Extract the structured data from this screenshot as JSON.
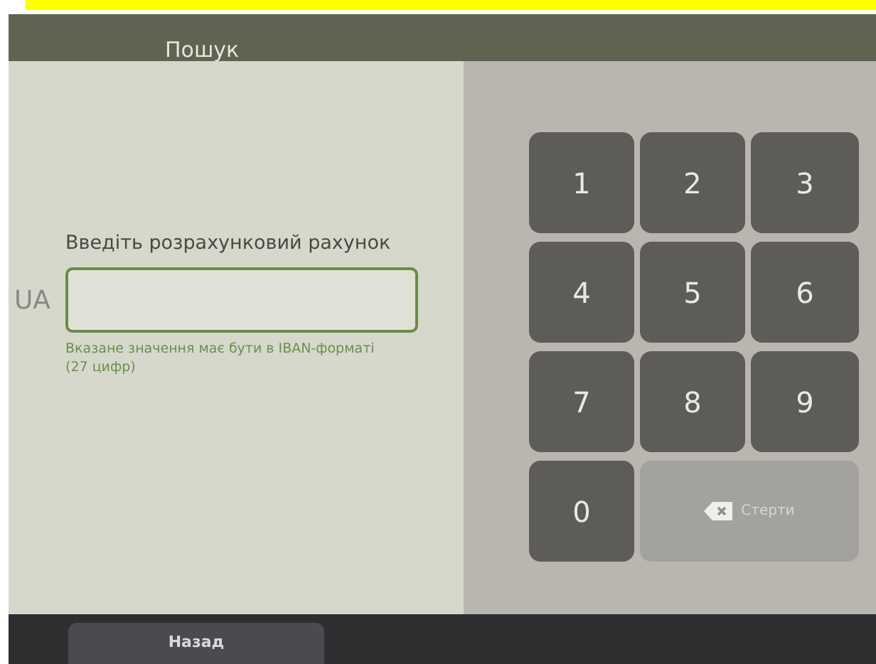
{
  "header": {
    "title": "Пошук"
  },
  "form": {
    "label": "Введіть розрахунковий рахунок",
    "prefix": "UA",
    "hint": "Вказане значення має бути в IBAN-форматі (27 цифр)"
  },
  "keypad": {
    "keys": [
      {
        "label": "1",
        "kind": "digit"
      },
      {
        "label": "2",
        "kind": "digit"
      },
      {
        "label": "3",
        "kind": "digit"
      },
      {
        "label": "4",
        "kind": "digit"
      },
      {
        "label": "5",
        "kind": "digit"
      },
      {
        "label": "6",
        "kind": "digit"
      },
      {
        "label": "7",
        "kind": "digit"
      },
      {
        "label": "8",
        "kind": "digit"
      },
      {
        "label": "9",
        "kind": "digit"
      },
      {
        "label": "0",
        "kind": "digit"
      },
      {
        "label": "Стерти",
        "kind": "erase",
        "disabled": true
      }
    ]
  },
  "footer": {
    "back_button": "Назад"
  }
}
